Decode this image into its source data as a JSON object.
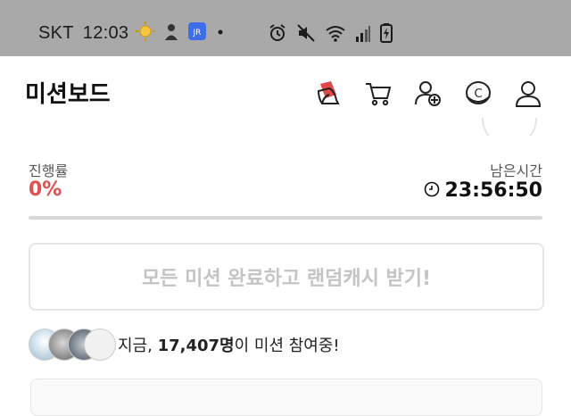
{
  "status_bar": {
    "carrier": "SKT",
    "time": "12:03"
  },
  "header": {
    "title": "미션보드"
  },
  "header_icons": [
    "cash-card-icon",
    "cart-icon",
    "add-friend-icon",
    "coin-icon",
    "profile-icon"
  ],
  "progress": {
    "label": "진행률",
    "value": "0%",
    "fraction": 0
  },
  "remaining": {
    "label": "남은시간",
    "time": "23:56:50"
  },
  "reward_button": {
    "label": "모든 미션 완료하고 랜덤캐시 받기!"
  },
  "participants": {
    "prefix": "지금, ",
    "count": "17,407명",
    "suffix": "이 미션 참여중!"
  },
  "colors": {
    "accent": "#e05050",
    "status_bar": "#a9a9a9",
    "disabled_text": "#c4c4c4"
  }
}
